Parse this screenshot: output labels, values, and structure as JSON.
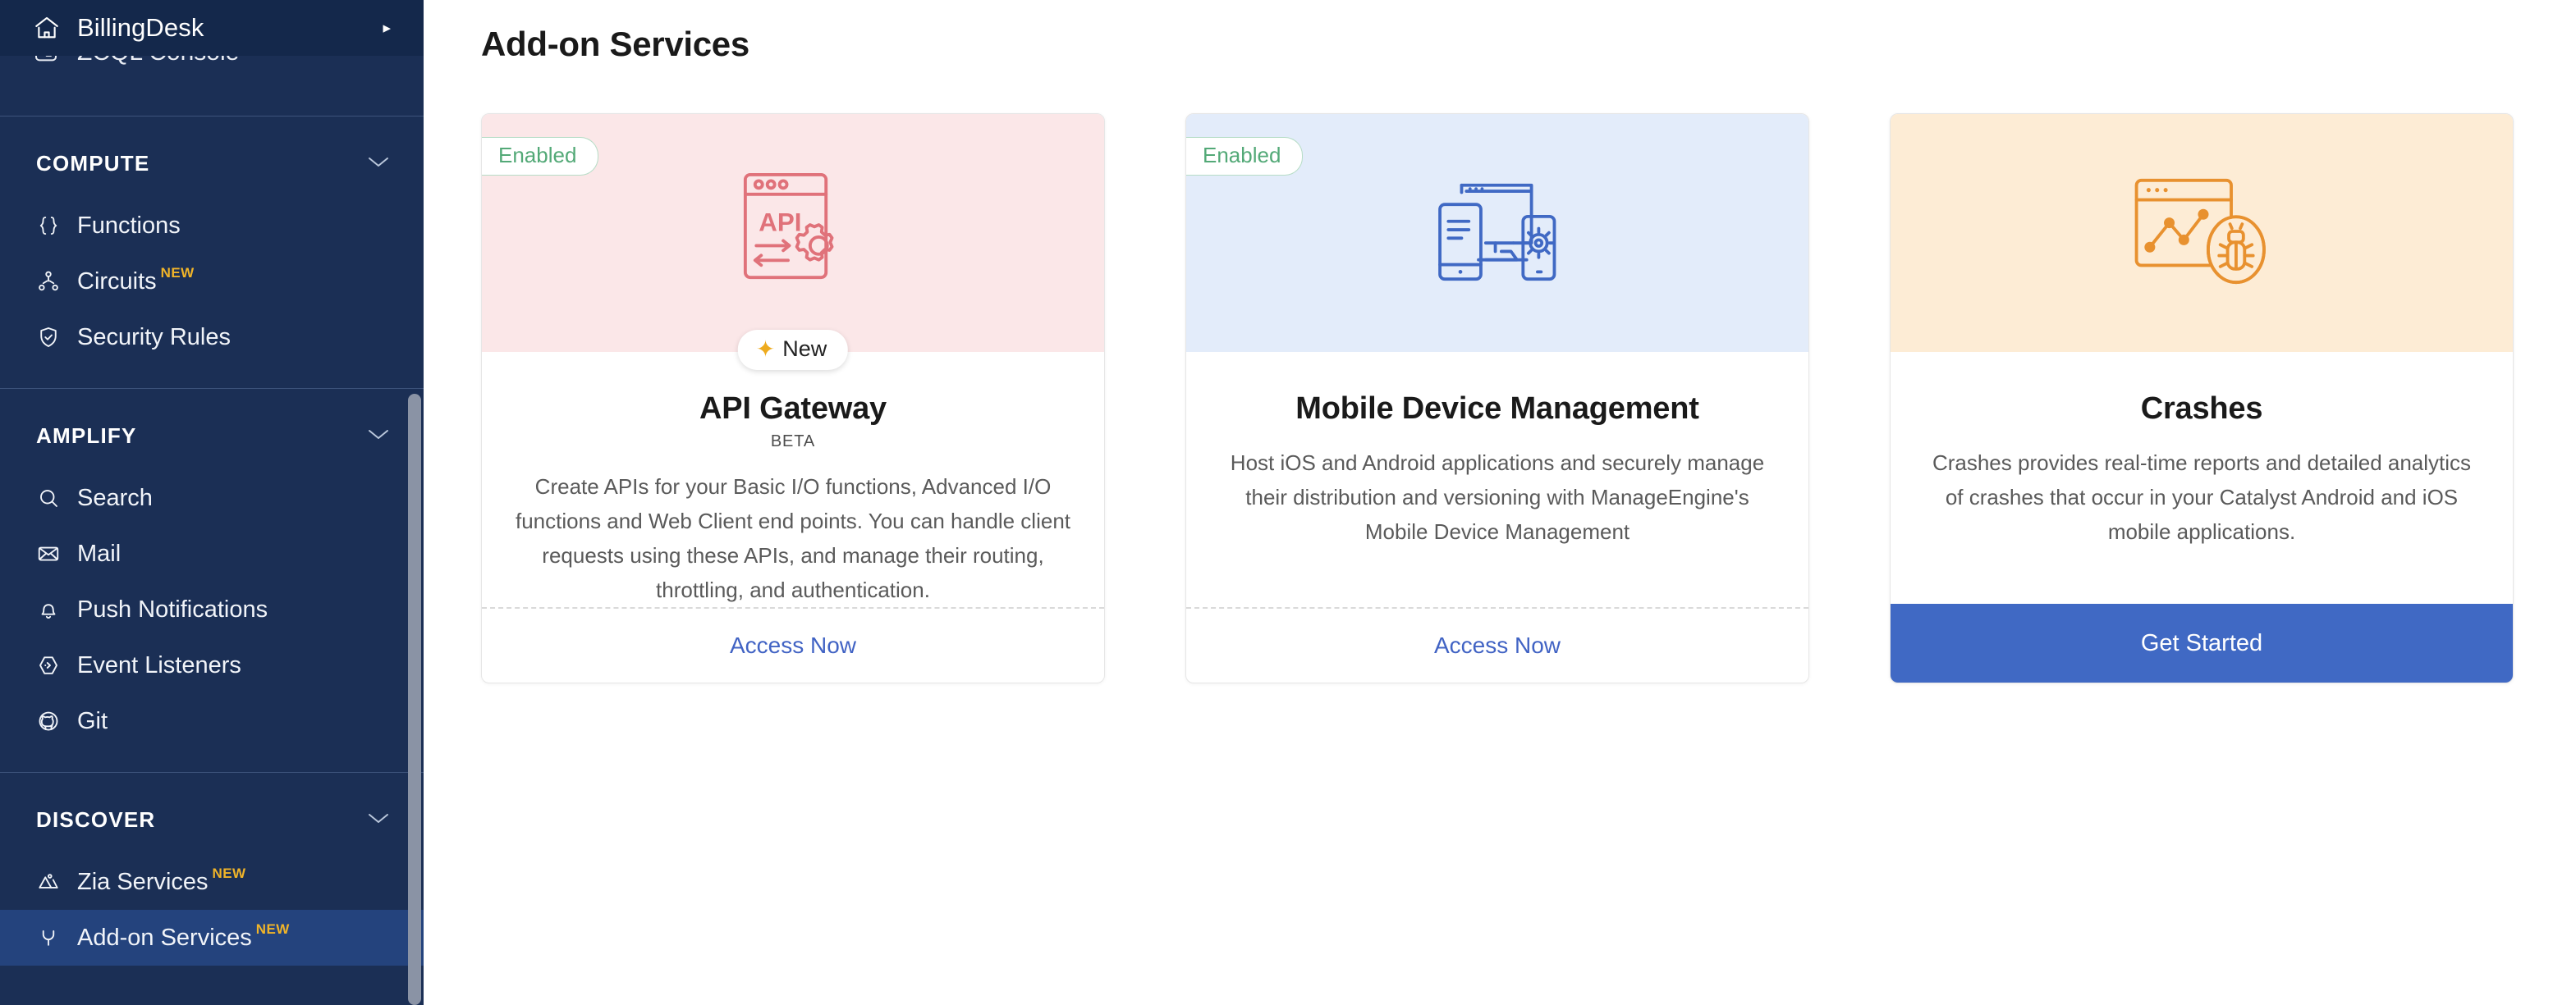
{
  "sidebar": {
    "brand": {
      "label": "BillingDesk",
      "icon": "home-icon",
      "caret": "chevron-right-icon"
    },
    "clipped_item": {
      "label": "ZCQL Console",
      "icon": "terminal-icon"
    },
    "groups": [
      {
        "title": "COMPUTE",
        "chevron": "chevron-down-icon",
        "items": [
          {
            "label": "Functions",
            "icon": "braces-icon",
            "badge": "",
            "active": false
          },
          {
            "label": "Circuits",
            "icon": "circuit-nodes-icon",
            "badge": "NEW",
            "active": false
          },
          {
            "label": "Security Rules",
            "icon": "shield-check-icon",
            "badge": "",
            "active": false
          }
        ]
      },
      {
        "title": "AMPLIFY",
        "chevron": "chevron-down-icon",
        "items": [
          {
            "label": "Search",
            "icon": "search-icon",
            "badge": "",
            "active": false
          },
          {
            "label": "Mail",
            "icon": "envelope-icon",
            "badge": "",
            "active": false
          },
          {
            "label": "Push Notifications",
            "icon": "bell-icon",
            "badge": "",
            "active": false
          },
          {
            "label": "Event Listeners",
            "icon": "hexagon-arrow-icon",
            "badge": "",
            "active": false
          },
          {
            "label": "Git",
            "icon": "git-icon",
            "badge": "",
            "active": false
          }
        ]
      },
      {
        "title": "DISCOVER",
        "chevron": "chevron-down-icon",
        "items": [
          {
            "label": "Zia Services",
            "icon": "zia-icon",
            "badge": "NEW",
            "active": false
          },
          {
            "label": "Add-on Services",
            "icon": "plug-icon",
            "badge": "NEW",
            "active": true
          }
        ]
      }
    ],
    "scrollbar": {
      "name": "sidebar-scrollbar"
    }
  },
  "main": {
    "page_title": "Add-on Services",
    "cards": [
      {
        "id": "api-gateway",
        "status_badge": "Enabled",
        "float_badge": "New",
        "float_badge_icon": "sparkle-icon",
        "hero_icon": "api-gateway-illustration",
        "hero_class": "hero-pink",
        "accent": "#e0727a",
        "title": "API Gateway",
        "subtitle": "BETA",
        "description": "Create APIs for your Basic I/O functions, Advanced I/O functions and Web Client end points. You can handle client requests using these APIs, and manage their routing, throttling, and authentication.",
        "footer_type": "link",
        "footer_label": "Access Now"
      },
      {
        "id": "mobile-device-management",
        "status_badge": "Enabled",
        "float_badge": "",
        "float_badge_icon": "",
        "hero_icon": "mobile-devices-illustration",
        "hero_class": "hero-blue",
        "accent": "#4069c4",
        "title": "Mobile Device Management",
        "subtitle": "",
        "description": "Host iOS and Android applications and securely manage their distribution and versioning with ManageEngine's Mobile Device Management",
        "footer_type": "link",
        "footer_label": "Access Now"
      },
      {
        "id": "crashes",
        "status_badge": "",
        "float_badge": "",
        "float_badge_icon": "",
        "hero_icon": "crash-analytics-illustration",
        "hero_class": "hero-cream",
        "accent": "#e8912f",
        "title": "Crashes",
        "subtitle": "",
        "description": "Crashes provides real-time reports and detailed analytics of crashes that occur in your Catalyst Android and iOS mobile applications.",
        "footer_type": "button",
        "footer_label": "Get Started"
      }
    ]
  },
  "colors": {
    "sidebar_bg": "#1b2f55",
    "sidebar_header_bg": "#14284b",
    "sidebar_active": "#24437d",
    "new_tag": "#f0b429",
    "link_blue": "#4163c4",
    "cta_blue": "#4069c4",
    "enabled_green": "#53a977"
  }
}
